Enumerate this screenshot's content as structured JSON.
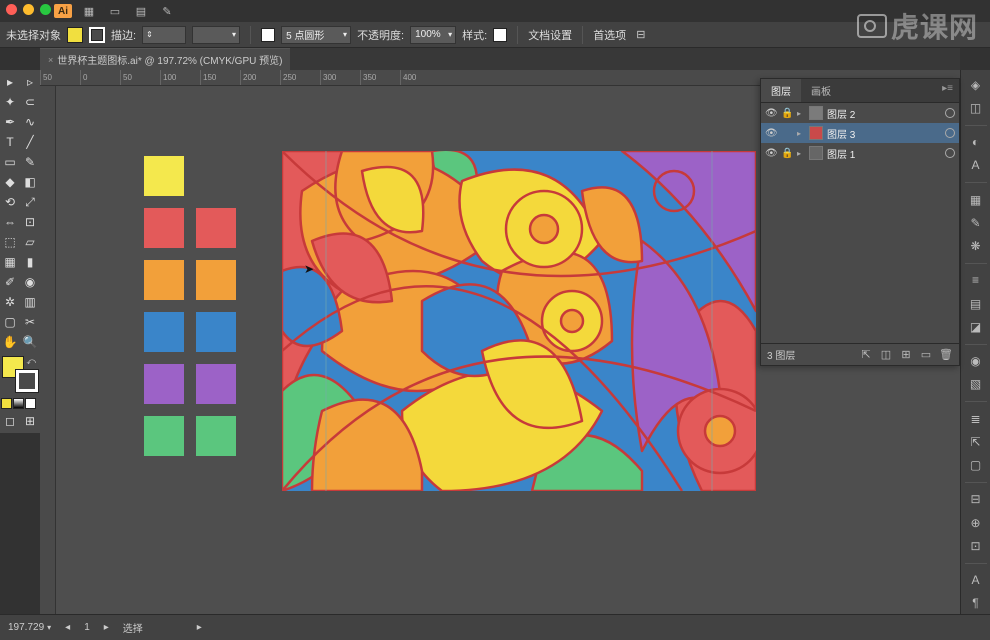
{
  "window": {
    "app_short": "Ai"
  },
  "optbar": {
    "no_selection": "未选择对象",
    "fill_color": "#f1df3f",
    "stroke_label": "描边:",
    "stroke_width": "",
    "stroke_profile": "5 点圆形",
    "opacity_label": "不透明度:",
    "opacity_value": "100%",
    "style_label": "样式:",
    "doc_setup": "文档设置",
    "prefs": "首选项"
  },
  "tab": {
    "title": "世界杯主题图标.ai* @ 197.72% (CMYK/GPU 预览)"
  },
  "ruler_marks": [
    "50",
    "0",
    "50",
    "100",
    "150",
    "200",
    "250",
    "300",
    "350",
    "400"
  ],
  "palette": [
    "#f4e84d",
    "",
    "#e35a5a",
    "#e35a5a",
    "#f2a03a",
    "#f2a03a",
    "#3a85c9",
    "#3a85c9",
    "#9c62c7",
    "#9c62c7",
    "#5bc67e",
    "#5bc67e"
  ],
  "layers": {
    "tab_layers": "图层",
    "tab_artboards": "画板",
    "rows": [
      {
        "name": "图层 2",
        "thumb": "#7b7b7b",
        "selected": false,
        "locked": true
      },
      {
        "name": "图层 3",
        "thumb": "#c94a4a",
        "selected": true,
        "locked": false
      },
      {
        "name": "图层 1",
        "thumb": "#666666",
        "selected": false,
        "locked": true
      }
    ],
    "footer_count": "3 图层"
  },
  "status": {
    "zoom": "197.729",
    "select_label": "选择"
  },
  "watermark": "虎课网",
  "art_colors": {
    "stroke": "#c73a3a",
    "yellow": "#f4d93b",
    "orange": "#f2a03a",
    "red": "#e35a5a",
    "blue": "#3a85c9",
    "purple": "#9c62c7",
    "green": "#5bc67e"
  }
}
